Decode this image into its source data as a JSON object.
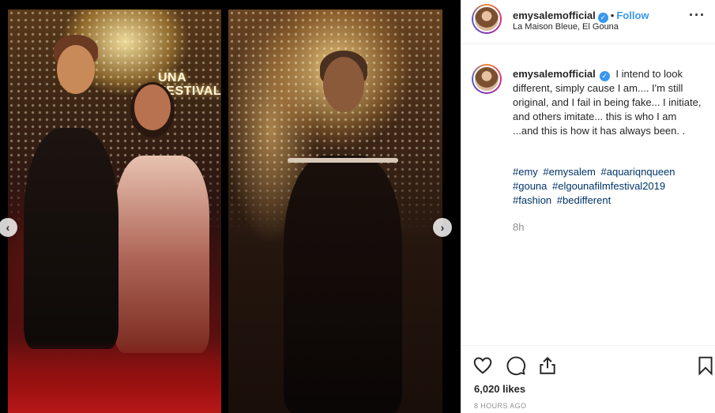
{
  "post": {
    "username": "emysalemofficial",
    "follow_label": "Follow",
    "separator": "•",
    "location": "La Maison Bleue, El Gouna",
    "more_label": "···",
    "caption_text": "I intend to look different, simply cause I am.... I'm still original, and I fail in being fake... I initiate, and others imitate... this is who I am ...and this is how it has always been. .",
    "hashtags": [
      "#emy",
      "#emysalem",
      "#aquariqnqueen",
      "#gouna",
      "#elgounafilmfestival2019",
      "#fashion",
      "#bedifferent"
    ],
    "caption_time": "8h",
    "likes": "6,020 likes",
    "timestamp": "8 HOURS AGO"
  },
  "media": {
    "festival_sign": "UNA\nFESTIVAL",
    "prev_arrow": "‹",
    "next_arrow": "›"
  },
  "icons": {
    "verified": "verified-badge-icon",
    "like": "heart-icon",
    "comment": "comment-icon",
    "share": "share-icon",
    "save": "bookmark-icon"
  },
  "colors": {
    "accent": "#3897f0",
    "hashtag": "#003569",
    "muted": "#8e8e8e",
    "text": "#262626"
  }
}
